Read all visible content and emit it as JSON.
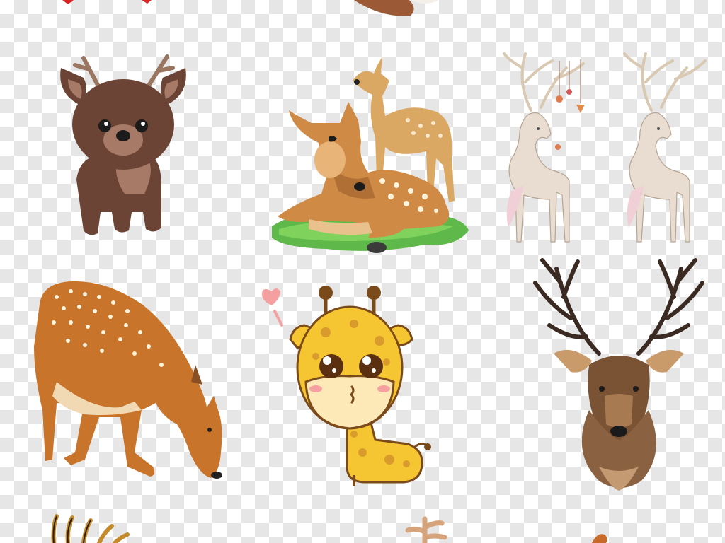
{
  "canvas": {
    "background": "transparency-checkerboard",
    "checker_color": "#e6e6e6",
    "base_color": "#ffffff"
  },
  "figures": [
    {
      "name": "cartoon-brown-deer",
      "color": "#6b4436"
    },
    {
      "name": "fawn-and-doe-on-grass",
      "color": "#c98b4a"
    },
    {
      "name": "white-watercolor-deer-pair",
      "color": "#e8ddd0"
    },
    {
      "name": "spotted-sika-deer-grazing",
      "color": "#c8742a"
    },
    {
      "name": "cartoon-giraffe-with-heart",
      "color": "#f6c532"
    },
    {
      "name": "watercolor-stag-head",
      "color": "#7a5234"
    },
    {
      "name": "partial-antlers-bottom",
      "color": "#8a5a2a"
    }
  ]
}
